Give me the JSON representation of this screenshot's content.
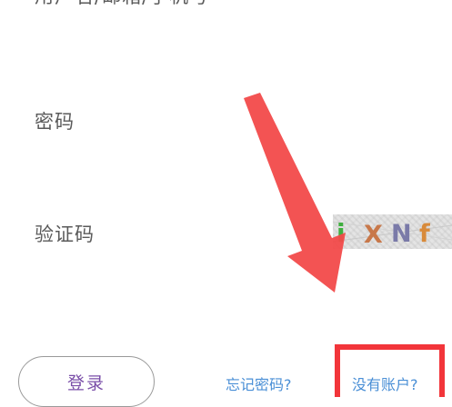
{
  "form": {
    "username_label": "用户名/邮箱/手机号",
    "password_label": "密码",
    "captcha_label": "验证码"
  },
  "captcha": {
    "chars": [
      "i",
      "X",
      "N",
      "f"
    ],
    "colors": [
      "#3fae3f",
      "#c8784a",
      "#7a7aa8",
      "#d88a3a"
    ]
  },
  "actions": {
    "login_label": "登录",
    "forgot_password_label": "忘记密码?",
    "no_account_label": "没有账户?"
  },
  "annotation": {
    "arrow_color": "#f24a4a",
    "box_color": "#f2353a"
  }
}
